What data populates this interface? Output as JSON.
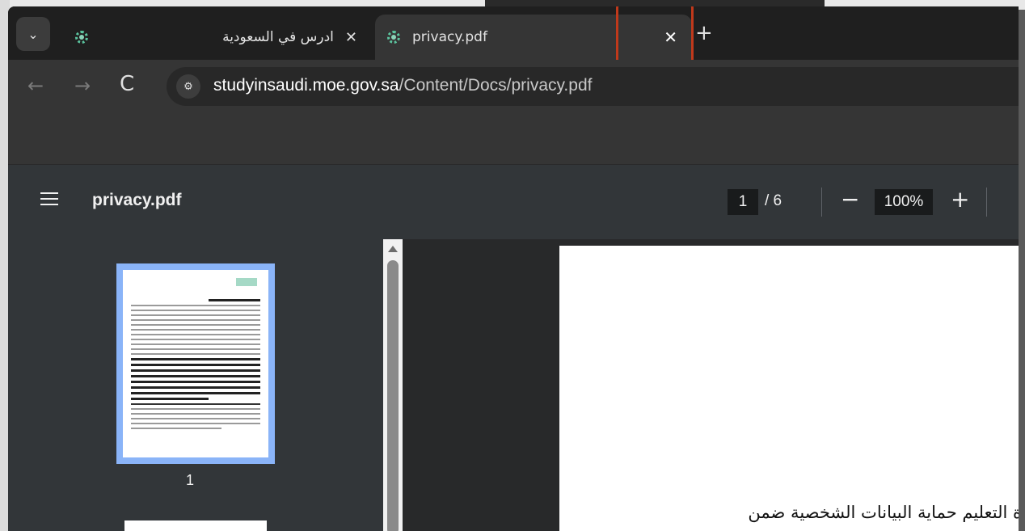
{
  "tabs": [
    {
      "title": "ادرس في السعودية",
      "close": "✕"
    },
    {
      "title": "privacy.pdf",
      "close": "✕"
    }
  ],
  "tab_search_icon": "chevron-down-icon",
  "new_tab": "+",
  "toolbar": {
    "back": "←",
    "forward": "→",
    "reload": "C",
    "url_domain": "studyinsaudi.moe.gov.sa",
    "url_path": "/Content/Docs/privacy.pdf"
  },
  "pdf_viewer": {
    "title": "privacy.pdf",
    "current_page": "1",
    "page_separator": "/ 6",
    "zoom_out": "−",
    "zoom": "100%",
    "zoom_in": "+",
    "thumbnail_label": "1",
    "page_text": "ة التعليم حماية البيانات الشخصية ضمن"
  },
  "colors": {
    "accent_highlight": "#c0391b",
    "thumb_selected": "#8ab4f8"
  }
}
